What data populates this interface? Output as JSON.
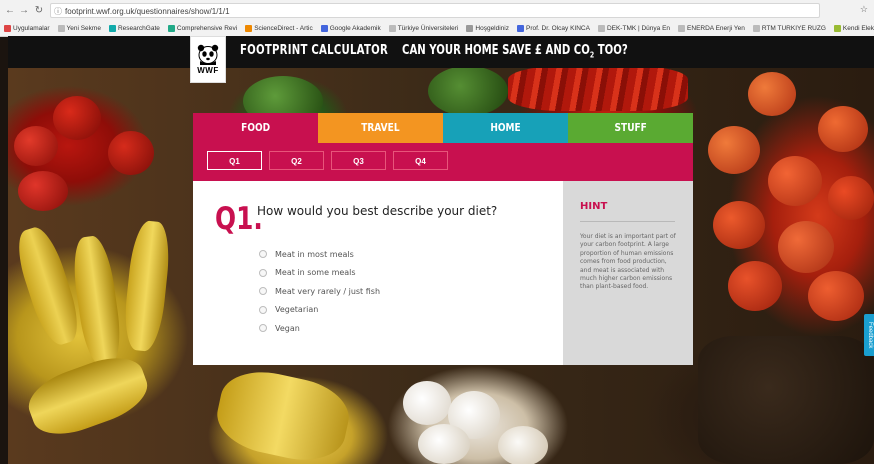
{
  "browser": {
    "url": "footprint.wwf.org.uk/questionnaires/show/1/1/1",
    "bookmarks": [
      {
        "label": "Uygulamalar",
        "color": "#d44"
      },
      {
        "label": "Yeni Sekme",
        "color": "#bbb"
      },
      {
        "label": "ResearchGate",
        "color": "#1aa"
      },
      {
        "label": "Comprehensive Revi",
        "color": "#2a8"
      },
      {
        "label": "ScienceDirect - Artic",
        "color": "#e80"
      },
      {
        "label": "Google Akademik",
        "color": "#46d"
      },
      {
        "label": "Türkiye Üniversiteleri",
        "color": "#bbb"
      },
      {
        "label": "Hoşgeldiniz",
        "color": "#999"
      },
      {
        "label": "Prof. Dr. Olcay KINCA",
        "color": "#46d"
      },
      {
        "label": "DEK-TMK | Dünya En",
        "color": "#bbb"
      },
      {
        "label": "ENERDA Enerji Yen",
        "color": "#bbb"
      },
      {
        "label": "RTM TURKIYE RUZG",
        "color": "#bbb"
      },
      {
        "label": "Kendi Elektriğini Kur",
        "color": "#9b3"
      }
    ]
  },
  "header": {
    "logo_text": "WWF",
    "title": "FOOTPRINT CALCULATOR",
    "tagline_pre": "CAN YOUR HOME SAVE £ AND CO",
    "tagline_sub": "2",
    "tagline_post": " TOO?"
  },
  "tabs": [
    {
      "label": "FOOD",
      "color": "#c8104f",
      "active": true
    },
    {
      "label": "TRAVEL",
      "color": "#f39521"
    },
    {
      "label": "HOME",
      "color": "#17a1b8"
    },
    {
      "label": "STUFF",
      "color": "#5aaa32"
    }
  ],
  "questions_nav": [
    "Q1",
    "Q2",
    "Q3",
    "Q4"
  ],
  "question": {
    "number": "Q1.",
    "text": "How would you best describe your diet?",
    "options": [
      "Meat in most meals",
      "Meat in some meals",
      "Meat very rarely / just fish",
      "Vegetarian",
      "Vegan"
    ]
  },
  "hint": {
    "title": "HINT",
    "body": "Your diet is an important part of your carbon footprint. A large proportion of human emissions comes from food production, and meat is associated with much higher carbon emissions than plant-based food."
  },
  "feedback_label": "Feedback",
  "colors": {
    "accent": "#c8104f",
    "header_bg": "#111111",
    "hint_bg": "#d9d9d9"
  }
}
